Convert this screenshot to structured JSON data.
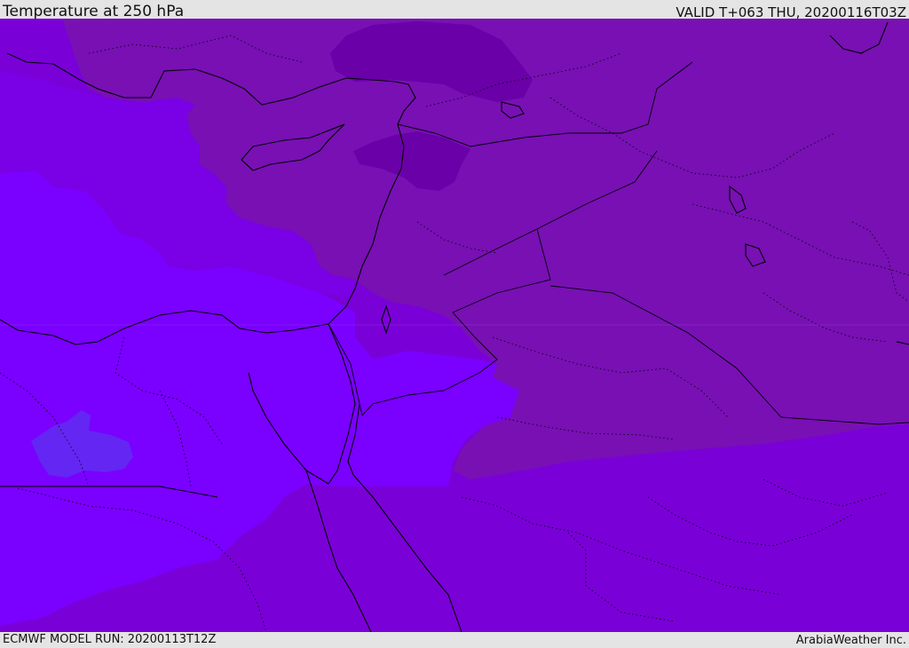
{
  "header": {
    "title": "Temperature at 250 hPa",
    "valid": "VALID T+063 THU, 20200116T03Z"
  },
  "footer": {
    "model_run": "ECMWF MODEL RUN: 20200113T12Z",
    "credit": "ArabiaWeather Inc."
  },
  "colors": {
    "coldest_core": "#6a00a8",
    "cold_zone": "#7810b4",
    "mid_zone": "#7a00d8",
    "warm_zone": "#7a00ff",
    "warm_patch": "#6426f2",
    "background": "#e4e4e4"
  }
}
